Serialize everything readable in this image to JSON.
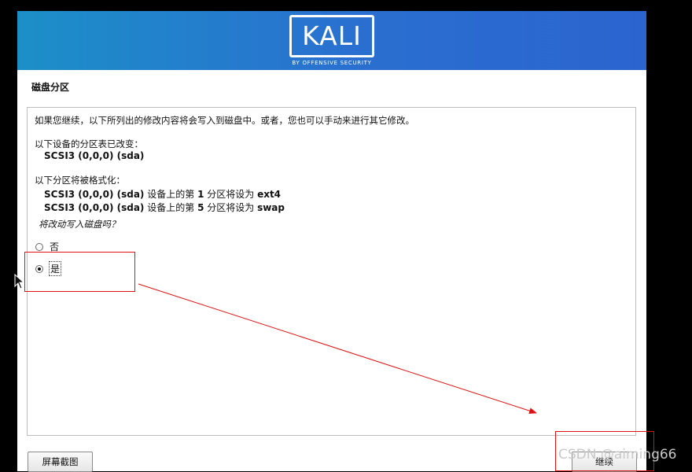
{
  "banner": {
    "logo_text": "KALI",
    "logo_subtitle": "BY OFFENSIVE SECURITY"
  },
  "page_title": "磁盘分区",
  "content": {
    "intro": "如果您继续，以下所列出的修改内容将会写入到磁盘中。或者，您也可以手动来进行其它修改。",
    "table_changed_label": "以下设备的分区表已改变：",
    "table_changed_device": "SCSI3 (0,0,0) (sda)",
    "format_label": "以下分区将被格式化：",
    "format_items": [
      {
        "device": "SCSI3 (0,0,0) (sda)",
        "mid1": " 设备上的第 ",
        "num": "1",
        "mid2": " 分区将设为 ",
        "fs": "ext4"
      },
      {
        "device": "SCSI3 (0,0,0) (sda)",
        "mid1": " 设备上的第 ",
        "num": "5",
        "mid2": " 分区将设为 ",
        "fs": "swap"
      }
    ],
    "question": "将改动写入磁盘吗？",
    "options": [
      {
        "label": "否",
        "selected": false
      },
      {
        "label": "是",
        "selected": true
      }
    ]
  },
  "buttons": {
    "screenshot": "屏幕截图",
    "continue": "继续"
  },
  "watermark": "CSDN @aiming66",
  "annotation_color": "#e01010"
}
